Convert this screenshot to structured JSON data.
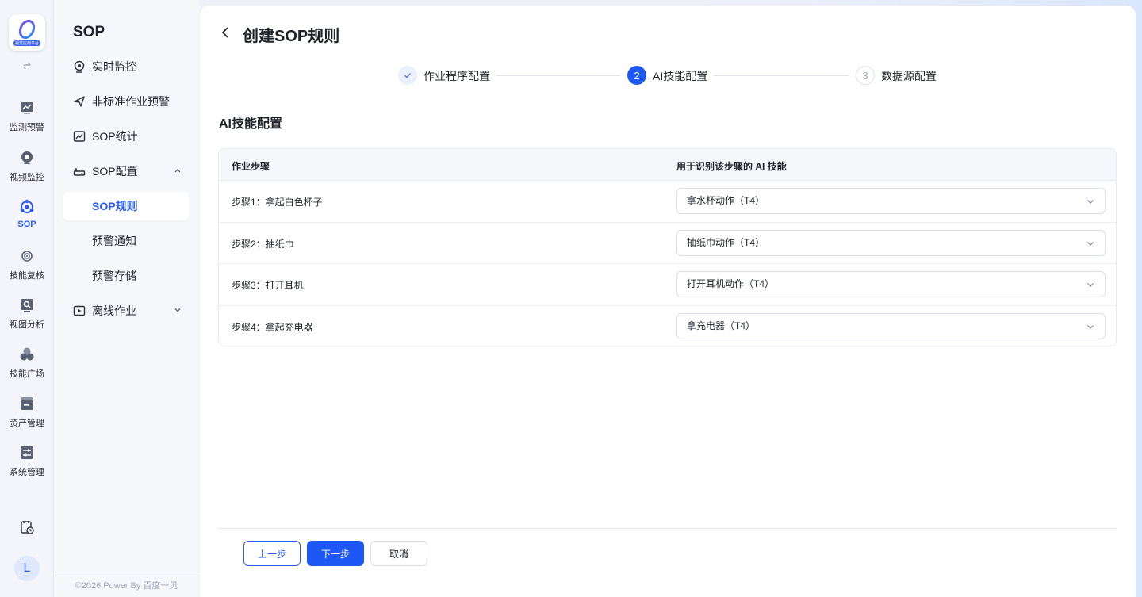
{
  "rail": {
    "logo_caption": "视觉应用平台",
    "items": [
      {
        "label": "监测预警",
        "icon": "monitor-chart-icon"
      },
      {
        "label": "视频监控",
        "icon": "camera-icon"
      },
      {
        "label": "SOP",
        "icon": "sop-icon",
        "active": true
      },
      {
        "label": "技能复核",
        "icon": "skill-review-icon"
      },
      {
        "label": "视图分析",
        "icon": "view-analysis-icon"
      },
      {
        "label": "技能广场",
        "icon": "skill-plaza-icon"
      },
      {
        "label": "资产管理",
        "icon": "asset-icon"
      },
      {
        "label": "系统管理",
        "icon": "system-icon"
      }
    ],
    "avatar_letter": "L"
  },
  "subnav": {
    "title": "SOP",
    "items": [
      {
        "label": "实时监控",
        "icon": "webcam-icon"
      },
      {
        "label": "非标准作业预警",
        "icon": "send-icon"
      },
      {
        "label": "SOP统计",
        "icon": "stats-icon"
      },
      {
        "label": "SOP配置",
        "icon": "router-icon",
        "expanded": true
      },
      {
        "label": "SOP规则",
        "active": true
      },
      {
        "label": "预警通知"
      },
      {
        "label": "预警存储"
      },
      {
        "label": "离线作业",
        "icon": "offline-icon",
        "expanded": false
      }
    ],
    "footer": "©2026 Power By 百度一见"
  },
  "page": {
    "title": "创建SOP规则",
    "steps": [
      {
        "index": "1",
        "label": "作业程序配置",
        "status": "done"
      },
      {
        "index": "2",
        "label": "AI技能配置",
        "status": "active"
      },
      {
        "index": "3",
        "label": "数据源配置",
        "status": "pending"
      }
    ],
    "section_title": "AI技能配置",
    "table": {
      "headers": [
        "作业步骤",
        "用于识别该步骤的 AI 技能"
      ],
      "rows": [
        {
          "step": "步骤1：拿起白色杯子",
          "skill": "拿水杯动作（T4）"
        },
        {
          "step": "步骤2：抽纸巾",
          "skill": "抽纸巾动作（T4）"
        },
        {
          "step": "步骤3：打开耳机",
          "skill": "打开耳机动作（T4）"
        },
        {
          "step": "步骤4：拿起充电器",
          "skill": "拿充电器（T4）"
        }
      ]
    },
    "buttons": {
      "prev": "上一步",
      "next": "下一步",
      "cancel": "取消"
    }
  },
  "colors": {
    "accent": "#1d57f6",
    "active_text": "#2a5bf5"
  }
}
